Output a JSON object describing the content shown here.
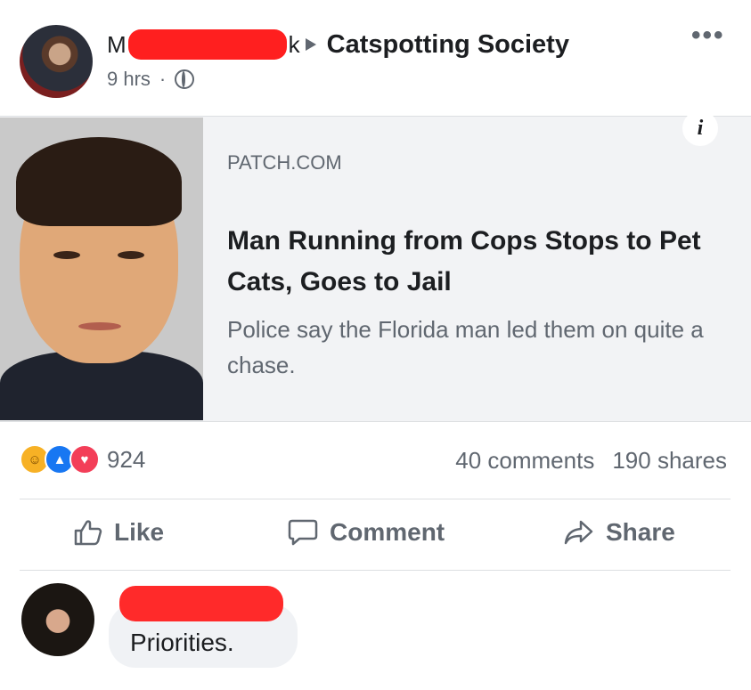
{
  "post": {
    "author_initial": "M",
    "author_last": "k",
    "group": "Catspotting Society",
    "time": "9 hrs",
    "dot": "·",
    "more": "•••"
  },
  "link_preview": {
    "domain": "PATCH.COM",
    "headline": "Man Running from Cops Stops to Pet Cats, Goes to Jail",
    "description": "Police say the Florida man led them on quite a chase.",
    "info": "i"
  },
  "engagement": {
    "reactions": [
      "haha",
      "like",
      "love"
    ],
    "reaction_count": "924",
    "comments": "40 comments",
    "shares": "190 shares"
  },
  "actions": {
    "like": "Like",
    "comment": "Comment",
    "share": "Share"
  },
  "comment": {
    "text": "Priorities."
  },
  "colors": {
    "redaction": "#ff1f1f",
    "meta_gray": "#606770",
    "card_bg": "#f2f3f5"
  }
}
